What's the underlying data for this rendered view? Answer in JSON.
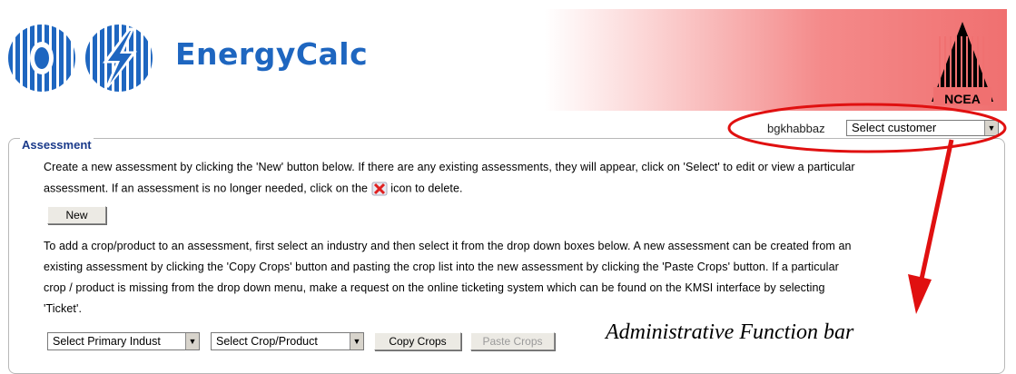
{
  "header": {
    "brand": "EnergyCalc",
    "ncea_label": "NCEA"
  },
  "user_bar": {
    "username": "bgkhabbaz",
    "customer_select": "Select customer"
  },
  "assessment": {
    "legend": "Assessment",
    "intro_line1": "Create a new assessment by clicking the 'New' button below. If there are any existing assessments, they will appear, click on 'Select' to edit or view a particular",
    "intro_line2_a": "assessment. If an assessment is no longer needed, click on the",
    "intro_line2_b": "icon to delete.",
    "new_button": "New",
    "crop_line1": "To add a crop/product to an assessment, first select an industry and then select it from the drop down boxes below. A new assessment can be created from an",
    "crop_line2": "existing assessment by clicking the 'Copy Crops' button and pasting the crop list into the new assessment by clicking the 'Paste Crops' button. If a particular",
    "crop_line3": "crop / product is missing from the drop down menu, make a request on the online ticketing system which can be found on the KMSI interface by selecting",
    "crop_line4": "'Ticket'.",
    "industry_select": "Select Primary Indust",
    "crop_select": "Select Crop/Product",
    "copy_button": "Copy Crops",
    "paste_button": "Paste Crops"
  },
  "annotation": {
    "text": "Administrative Function bar",
    "color": "#e01010"
  },
  "colors": {
    "brand": "#1e66c0",
    "legend": "#1a3a8a",
    "gradient_end": "#f07070"
  },
  "icons": [
    "dual-globe-logo",
    "lightning-icon",
    "ncea-tower-logo",
    "delete-icon",
    "dropdown-arrow-icon"
  ]
}
